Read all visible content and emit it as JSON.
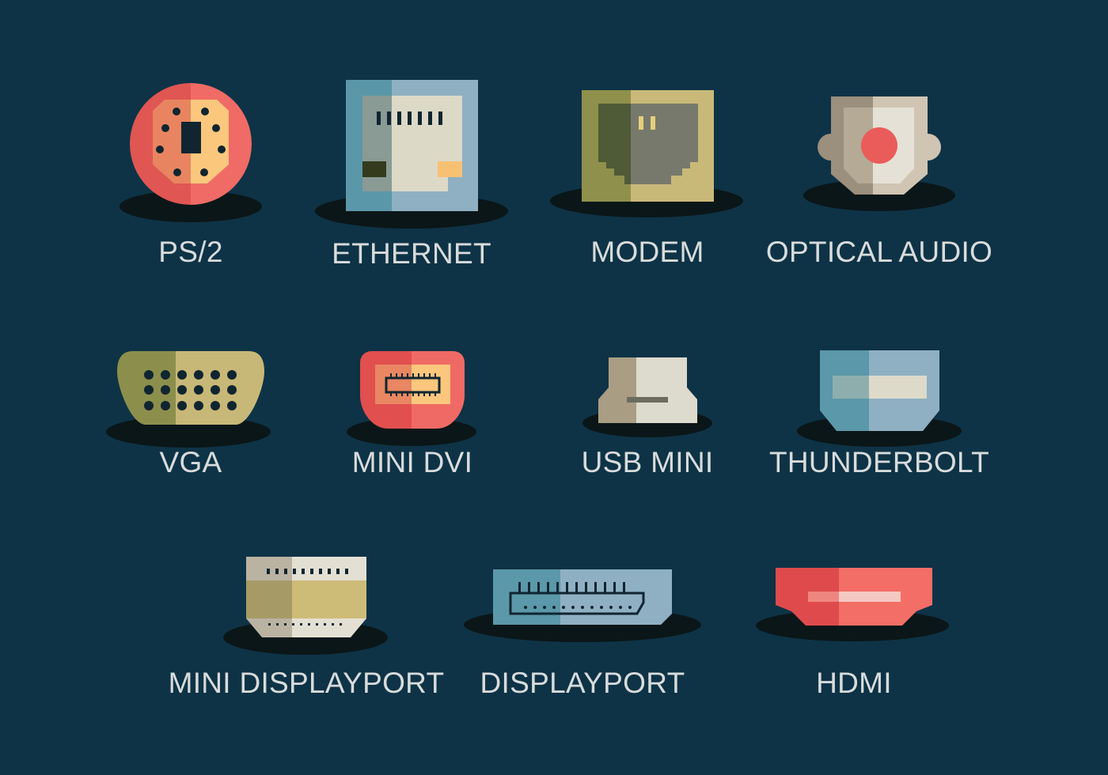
{
  "background": "#0e3346",
  "ports": [
    {
      "id": "ps2",
      "label": "PS/2",
      "icon": "ps2-port-icon"
    },
    {
      "id": "ethernet",
      "label": "ETHERNET",
      "icon": "ethernet-port-icon"
    },
    {
      "id": "modem",
      "label": "MODEM",
      "icon": "modem-port-icon"
    },
    {
      "id": "optical",
      "label": "OPTICAL AUDIO",
      "icon": "optical-audio-port-icon"
    },
    {
      "id": "vga",
      "label": "VGA",
      "icon": "vga-port-icon"
    },
    {
      "id": "minidvi",
      "label": "MINI DVI",
      "icon": "mini-dvi-port-icon"
    },
    {
      "id": "usbmini",
      "label": "USB MINI",
      "icon": "usb-mini-port-icon"
    },
    {
      "id": "thunderbolt",
      "label": "THUNDERBOLT",
      "icon": "thunderbolt-port-icon"
    },
    {
      "id": "minidp",
      "label": "MINI DISPLAYPORT",
      "icon": "mini-displayport-port-icon"
    },
    {
      "id": "displayport",
      "label": "DISPLAYPORT",
      "icon": "displayport-port-icon"
    },
    {
      "id": "hdmi",
      "label": "HDMI",
      "icon": "hdmi-port-icon"
    }
  ]
}
